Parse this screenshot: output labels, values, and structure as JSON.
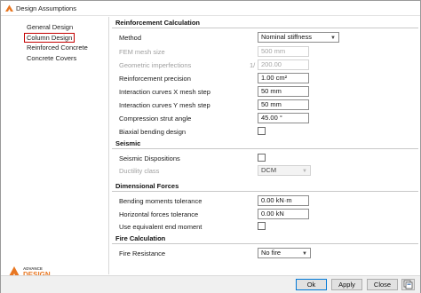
{
  "window": {
    "title": "Design Assumptions"
  },
  "sidebar": {
    "items": [
      {
        "label": "General Design",
        "active": false
      },
      {
        "label": "Column Design",
        "active": true
      },
      {
        "label": "Reinforced Concrete",
        "active": false
      },
      {
        "label": "Concrete Covers",
        "active": false
      }
    ],
    "logo_text_top": "ADVANCE",
    "logo_text_bottom": "DESIGN"
  },
  "sections": {
    "reinforcement": {
      "title": "Reinforcement Calculation",
      "method_label": "Method",
      "method_value": "Nominal stiffness",
      "fem_mesh_label": "FEM mesh size",
      "fem_mesh_value": "500 mm",
      "geom_label": "Geometric imperfections",
      "geom_prefix": "1/",
      "geom_value": "200.00",
      "precision_label": "Reinforcement precision",
      "precision_value": "1.00 cm²",
      "curves_x_label": "Interaction curves X mesh step",
      "curves_x_value": "50 mm",
      "curves_y_label": "Interaction curves Y mesh step",
      "curves_y_value": "50 mm",
      "strut_label": "Compression strut angle",
      "strut_value": "45.00 °",
      "biaxial_label": "Biaxial bending design"
    },
    "seismic": {
      "title": "Seismic",
      "dispositions_label": "Seismic Dispositions",
      "ductility_label": "Ductility class",
      "ductility_value": "DCM"
    },
    "dimensional": {
      "title": "Dimensional Forces",
      "bending_label": "Bending moments tolerance",
      "bending_value": "0.00 kN·m",
      "horizontal_label": "Horizontal forces tolerance",
      "horizontal_value": "0.00 kN",
      "equivalent_label": "Use equivalent end moment"
    },
    "fire": {
      "title": "Fire Calculation",
      "resistance_label": "Fire Resistance",
      "resistance_value": "No fire"
    }
  },
  "footer": {
    "ok_label": "Ok",
    "apply_label": "Apply",
    "close_label": "Close"
  },
  "colors": {
    "active_border": "#c40000",
    "logo_accent": "#e87722",
    "ok_border": "#0078d7"
  }
}
